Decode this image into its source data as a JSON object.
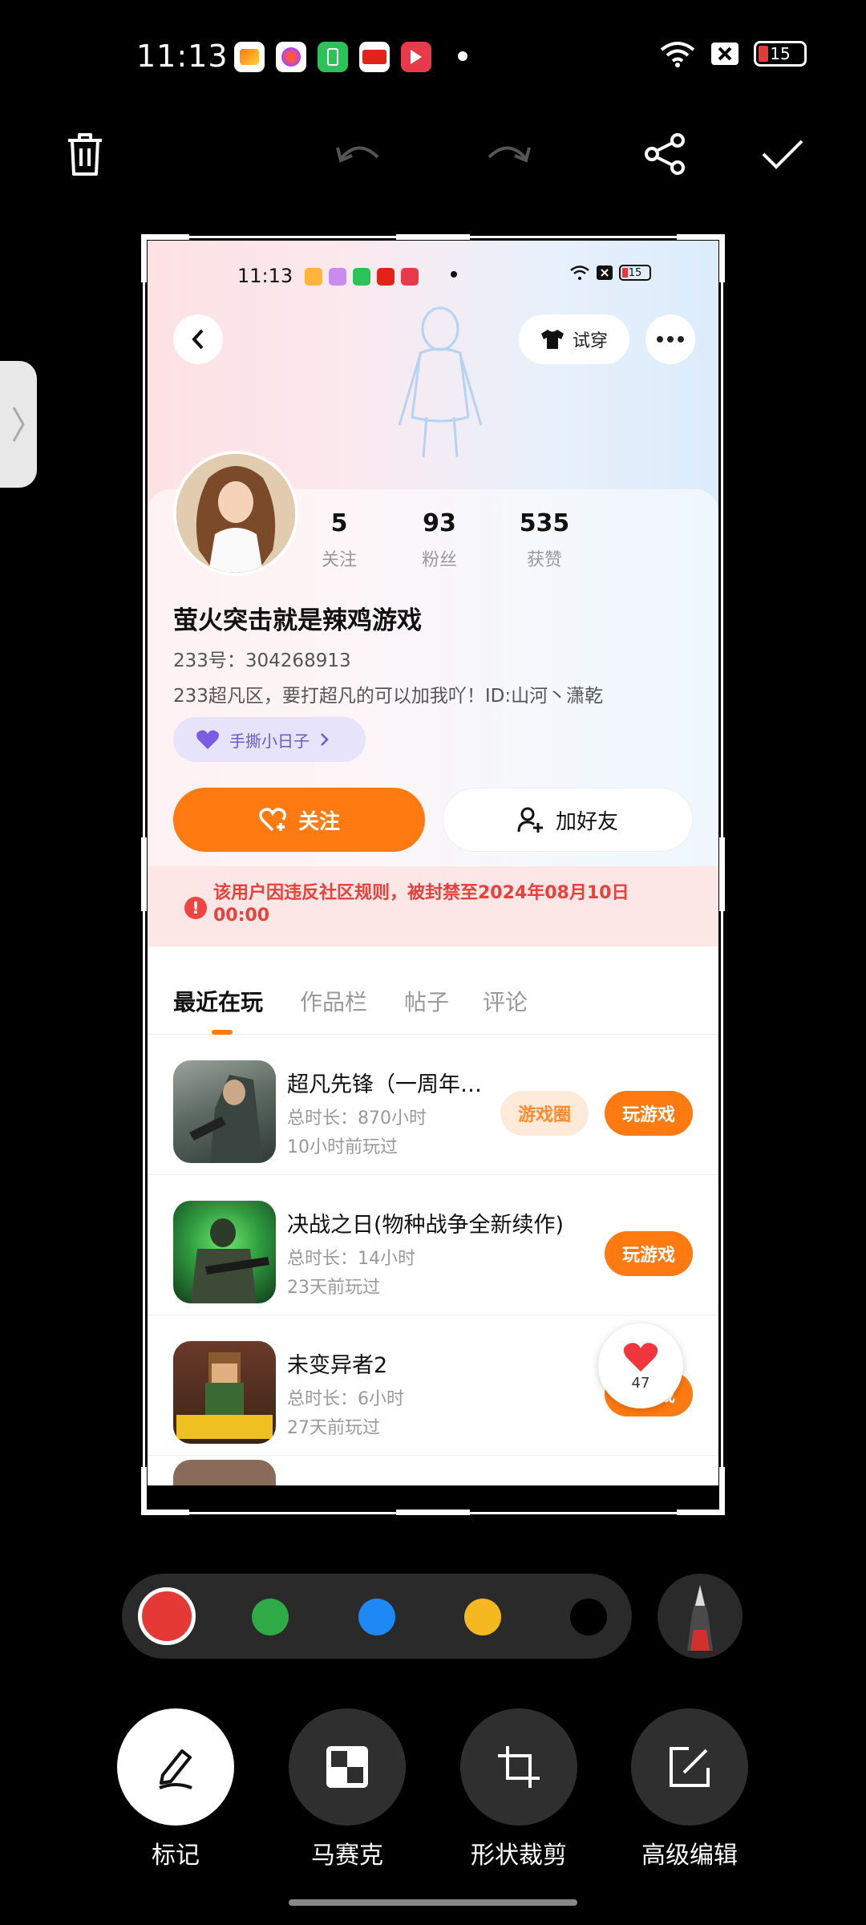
{
  "status_bar": {
    "time": "11:13",
    "battery": "15"
  },
  "inner_status_bar": {
    "time": "11:13",
    "battery": "15"
  },
  "toolbar": {
    "icons": [
      "trash-icon",
      "undo-icon",
      "redo-icon",
      "share-icon",
      "check-icon"
    ]
  },
  "profile": {
    "try_on_label": "试穿",
    "stats": [
      {
        "value": "5",
        "label": "关注"
      },
      {
        "value": "93",
        "label": "粉丝"
      },
      {
        "value": "535",
        "label": "获赞"
      }
    ],
    "username": "萤火突击就是辣鸡游戏",
    "id_line": "233号：304268913",
    "bio": "233超凡区，要打超凡的可以加我吖！ID:山河丶潇乾",
    "tag": "手撕小日子",
    "follow_label": "关注",
    "add_friend_label": "加好友",
    "ban_notice": "该用户因违反社区规则，被封禁至2024年08月10日 00:00"
  },
  "tabs": [
    "最近在玩",
    "作品栏",
    "帖子",
    "评论"
  ],
  "games": [
    {
      "name": "超凡先锋（一周年…",
      "total": "总时长：870小时",
      "last": "10小时前玩过",
      "circle_label": "游戏圈",
      "play_label": "玩游戏"
    },
    {
      "name": "决战之日(物种战争全新续作)",
      "total": "总时长：14小时",
      "last": "23天前玩过",
      "play_label": "玩游戏"
    },
    {
      "name": "未变异者2",
      "total": "总时长：6小时",
      "last": "27天前玩过",
      "play_label": "玩游戏"
    }
  ],
  "like_count": "47",
  "palette": {
    "colors": [
      "#e53935",
      "#2eaa46",
      "#1e88f5",
      "#f5b820",
      "#000000"
    ],
    "selected": 0
  },
  "tools": [
    {
      "label": "标记",
      "icon": "pen-mark-icon"
    },
    {
      "label": "马赛克",
      "icon": "mosaic-icon"
    },
    {
      "label": "形状裁剪",
      "icon": "crop-icon"
    },
    {
      "label": "高级编辑",
      "icon": "edit-icon"
    }
  ],
  "colors": {
    "accent": "#ff7a10",
    "ban_red": "#e8413c",
    "tag_purple": "#6a5acd"
  }
}
